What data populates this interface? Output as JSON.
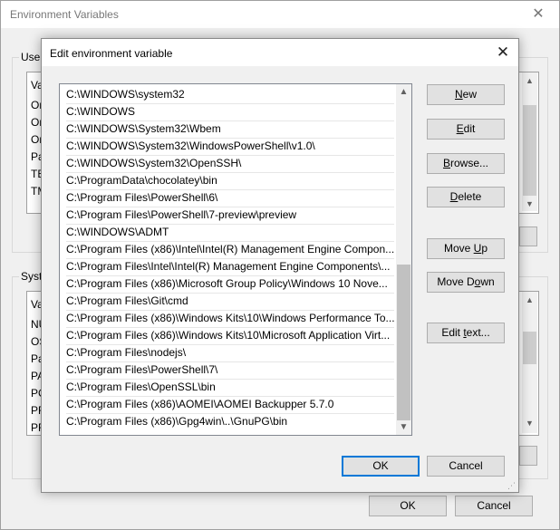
{
  "parent": {
    "title": "Environment Variables",
    "user_group_label": "User",
    "system_group_label": "Syste",
    "user_list": [
      "Va",
      "On",
      "On",
      "On",
      "Pa",
      "TE",
      "TM"
    ],
    "system_list": [
      "Va",
      "NU",
      "OS",
      "Pa",
      "PA",
      "PC",
      "PR",
      "PR"
    ],
    "ok_label": "OK",
    "cancel_label": "Cancel"
  },
  "dialog": {
    "title": "Edit environment variable",
    "close_glyph": "✕",
    "entries": [
      "C:\\WINDOWS\\system32",
      "C:\\WINDOWS",
      "C:\\WINDOWS\\System32\\Wbem",
      "C:\\WINDOWS\\System32\\WindowsPowerShell\\v1.0\\",
      "C:\\WINDOWS\\System32\\OpenSSH\\",
      "C:\\ProgramData\\chocolatey\\bin",
      "C:\\Program Files\\PowerShell\\6\\",
      "C:\\Program Files\\PowerShell\\7-preview\\preview",
      "C:\\WINDOWS\\ADMT",
      "C:\\Program Files (x86)\\Intel\\Intel(R) Management Engine Compon...",
      "C:\\Program Files\\Intel\\Intel(R) Management Engine Components\\...",
      "C:\\Program Files (x86)\\Microsoft Group Policy\\Windows 10 Nove...",
      "C:\\Program Files\\Git\\cmd",
      "C:\\Program Files (x86)\\Windows Kits\\10\\Windows Performance To...",
      "C:\\Program Files (x86)\\Windows Kits\\10\\Microsoft Application Virt...",
      "C:\\Program Files\\nodejs\\",
      "C:\\Program Files\\PowerShell\\7\\",
      "C:\\Program Files\\OpenSSL\\bin",
      "C:\\Program Files (x86)\\AOMEI\\AOMEI Backupper 5.7.0",
      "C:\\Program Files (x86)\\Gpg4win\\..\\GnuPG\\bin"
    ],
    "buttons": {
      "new": {
        "pre": "",
        "u": "N",
        "post": "ew"
      },
      "edit": {
        "pre": "",
        "u": "E",
        "post": "dit"
      },
      "browse": {
        "pre": "",
        "u": "B",
        "post": "rowse..."
      },
      "delete": {
        "pre": "",
        "u": "D",
        "post": "elete"
      },
      "move_up": {
        "pre": "Move ",
        "u": "U",
        "post": "p"
      },
      "move_down": {
        "pre": "Move D",
        "u": "o",
        "post": "wn"
      },
      "edit_text": {
        "pre": "Edit ",
        "u": "t",
        "post": "ext..."
      },
      "ok": "OK",
      "cancel": "Cancel"
    },
    "scroll_up_glyph": "▲",
    "scroll_down_glyph": "▼"
  }
}
